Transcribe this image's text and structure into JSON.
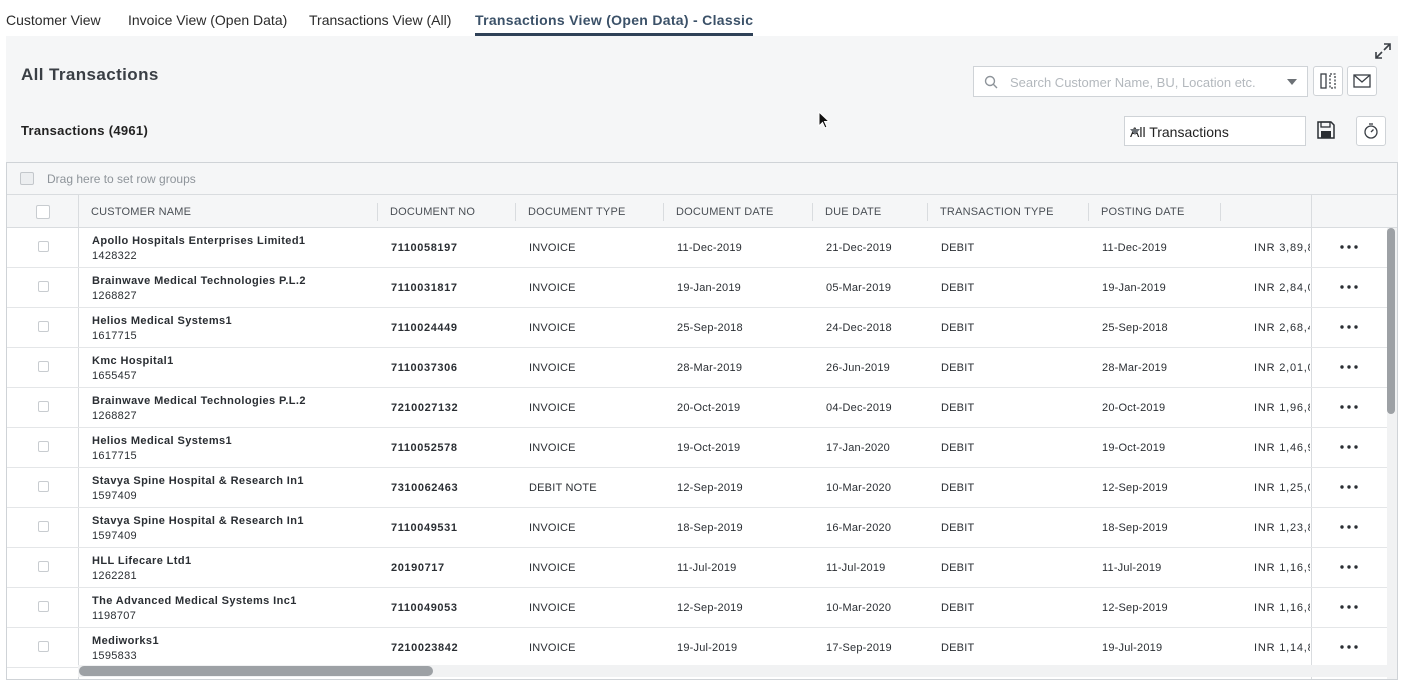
{
  "tabs": [
    {
      "label": "Customer View"
    },
    {
      "label": "Invoice View (Open Data)"
    },
    {
      "label": "Transactions View (All)"
    },
    {
      "label": "Transactions View (Open Data) - Classic",
      "active": true
    }
  ],
  "panel": {
    "title": "All Transactions",
    "subtitle": "Transactions (4961)",
    "search_placeholder": "Search Customer Name, BU, Location etc.",
    "filter_selected": "All Transactions"
  },
  "grid": {
    "group_hint": "Drag here to set row groups",
    "columns": [
      "CUSTOMER NAME",
      "DOCUMENT NO",
      "DOCUMENT TYPE",
      "DOCUMENT DATE",
      "DUE DATE",
      "TRANSACTION TYPE",
      "POSTING DATE"
    ],
    "rows": [
      {
        "name": "Apollo Hospitals Enterprises Limited1",
        "id": "1428322",
        "doc_no": "7110058197",
        "doc_type": "INVOICE",
        "doc_date": "11-Dec-2019",
        "due_date": "21-Dec-2019",
        "txn_type": "DEBIT",
        "posting_date": "11-Dec-2019",
        "amount": "INR 3,89,8"
      },
      {
        "name": "Brainwave Medical Technologies P.L.2",
        "id": "1268827",
        "doc_no": "7110031817",
        "doc_type": "INVOICE",
        "doc_date": "19-Jan-2019",
        "due_date": "05-Mar-2019",
        "txn_type": "DEBIT",
        "posting_date": "19-Jan-2019",
        "amount": "INR 2,84,0"
      },
      {
        "name": "Helios Medical Systems1",
        "id": "1617715",
        "doc_no": "7110024449",
        "doc_type": "INVOICE",
        "doc_date": "25-Sep-2018",
        "due_date": "24-Dec-2018",
        "txn_type": "DEBIT",
        "posting_date": "25-Sep-2018",
        "amount": "INR 2,68,4"
      },
      {
        "name": "Kmc Hospital1",
        "id": "1655457",
        "doc_no": "7110037306",
        "doc_type": "INVOICE",
        "doc_date": "28-Mar-2019",
        "due_date": "26-Jun-2019",
        "txn_type": "DEBIT",
        "posting_date": "28-Mar-2019",
        "amount": "INR 2,01,0"
      },
      {
        "name": "Brainwave Medical Technologies P.L.2",
        "id": "1268827",
        "doc_no": "7210027132",
        "doc_type": "INVOICE",
        "doc_date": "20-Oct-2019",
        "due_date": "04-Dec-2019",
        "txn_type": "DEBIT",
        "posting_date": "20-Oct-2019",
        "amount": "INR 1,96,8"
      },
      {
        "name": "Helios Medical Systems1",
        "id": "1617715",
        "doc_no": "7110052578",
        "doc_type": "INVOICE",
        "doc_date": "19-Oct-2019",
        "due_date": "17-Jan-2020",
        "txn_type": "DEBIT",
        "posting_date": "19-Oct-2019",
        "amount": "INR 1,46,9"
      },
      {
        "name": "Stavya Spine Hospital & Research In1",
        "id": "1597409",
        "doc_no": "7310062463",
        "doc_type": "DEBIT NOTE",
        "doc_date": "12-Sep-2019",
        "due_date": "10-Mar-2020",
        "txn_type": "DEBIT",
        "posting_date": "12-Sep-2019",
        "amount": "INR 1,25,0"
      },
      {
        "name": "Stavya Spine Hospital & Research In1",
        "id": "1597409",
        "doc_no": "7110049531",
        "doc_type": "INVOICE",
        "doc_date": "18-Sep-2019",
        "due_date": "16-Mar-2020",
        "txn_type": "DEBIT",
        "posting_date": "18-Sep-2019",
        "amount": "INR 1,23,8"
      },
      {
        "name": "HLL Lifecare Ltd1",
        "id": "1262281",
        "doc_no": "20190717",
        "doc_type": "INVOICE",
        "doc_date": "11-Jul-2019",
        "due_date": "11-Jul-2019",
        "txn_type": "DEBIT",
        "posting_date": "11-Jul-2019",
        "amount": "INR 1,16,9"
      },
      {
        "name": "The Advanced Medical Systems Inc1",
        "id": "1198707",
        "doc_no": "7110049053",
        "doc_type": "INVOICE",
        "doc_date": "12-Sep-2019",
        "due_date": "10-Mar-2020",
        "txn_type": "DEBIT",
        "posting_date": "12-Sep-2019",
        "amount": "INR 1,16,8"
      },
      {
        "name": "Mediworks1",
        "id": "1595833",
        "doc_no": "7210023842",
        "doc_type": "INVOICE",
        "doc_date": "19-Jul-2019",
        "due_date": "17-Sep-2019",
        "txn_type": "DEBIT",
        "posting_date": "19-Jul-2019",
        "amount": "INR 1,14,8"
      }
    ]
  },
  "icons": {
    "expand": "expand-icon",
    "search": "search-icon",
    "columns": "columns-icon",
    "mail": "mail-icon",
    "save": "save-icon",
    "timer": "timer-icon",
    "row_menu": "more-horizontal-icon"
  },
  "colors": {
    "accent": "#2f4157",
    "panel_bg": "#f5f6f7",
    "border": "#cfd3d7"
  }
}
